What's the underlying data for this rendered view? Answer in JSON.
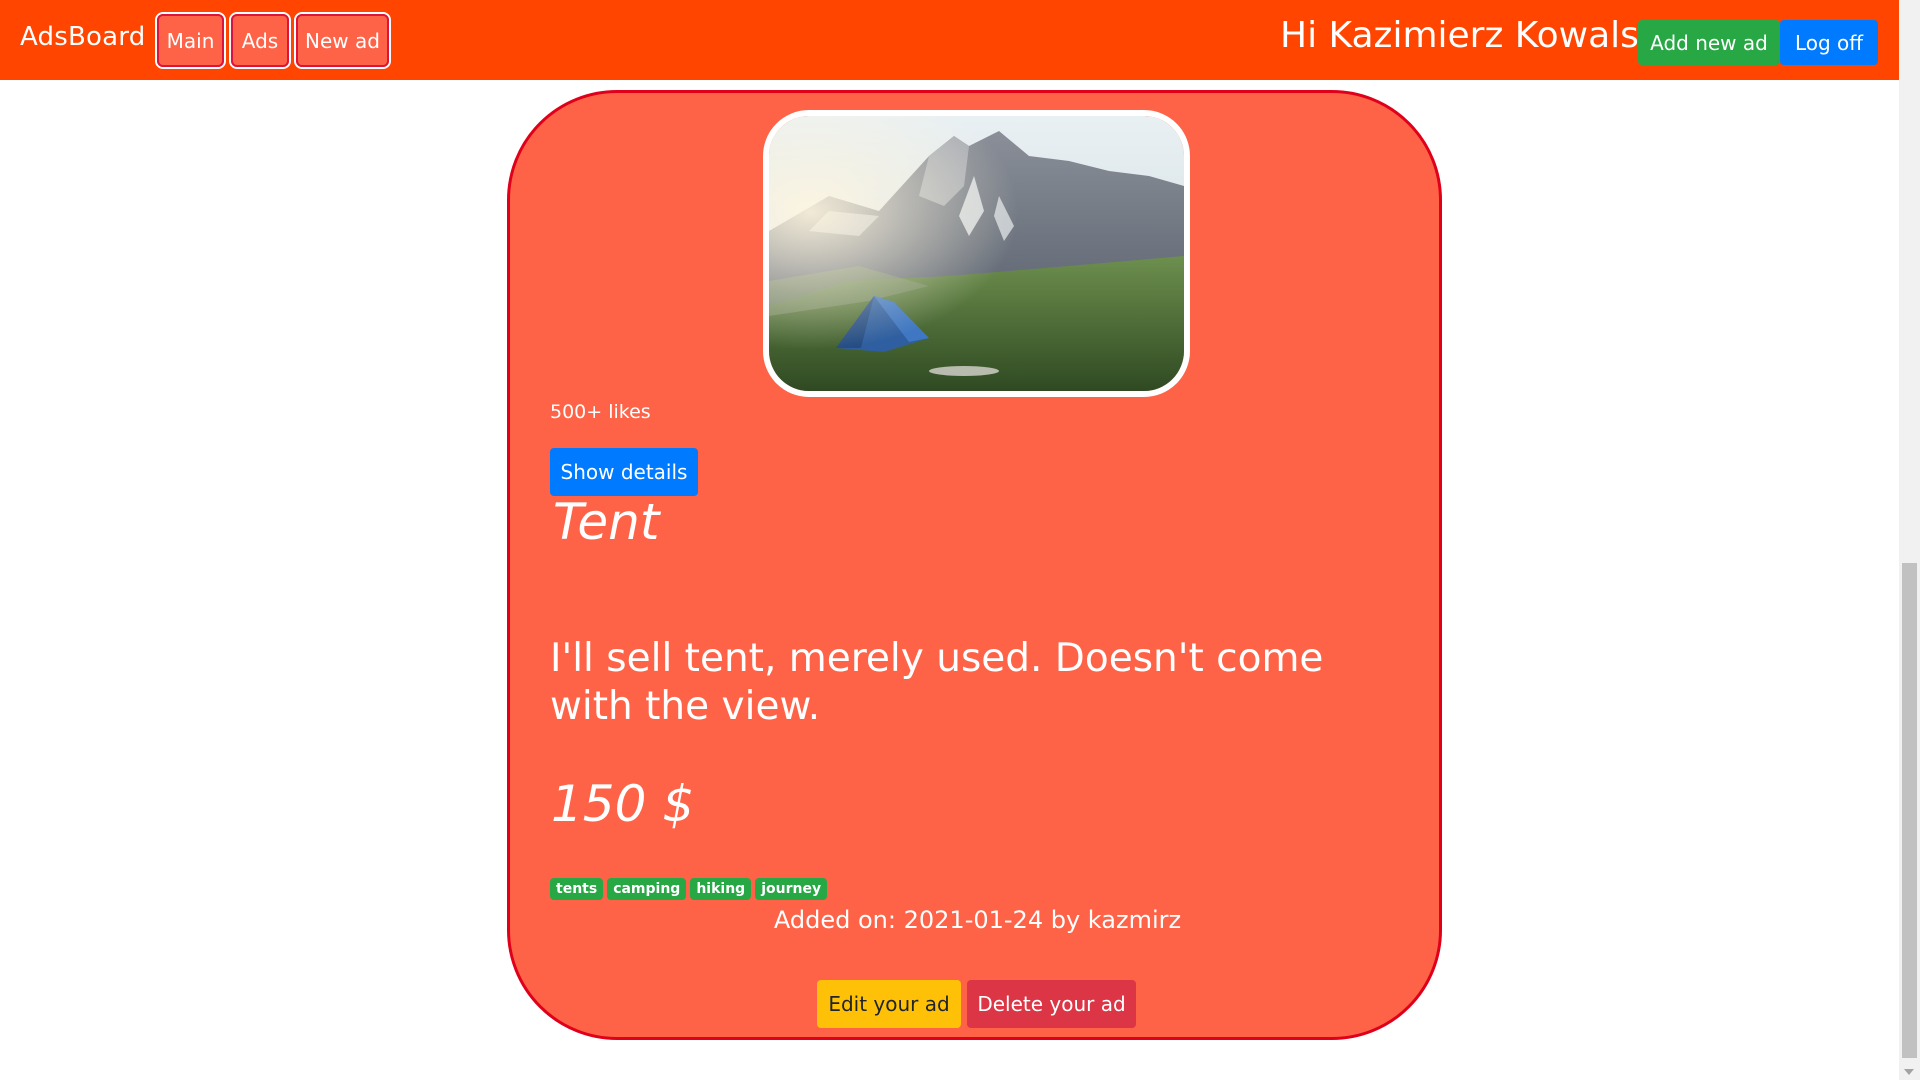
{
  "navbar": {
    "brand": "AdsBoard",
    "links": [
      "Main",
      "Ads",
      "New ad"
    ],
    "greeting": "Hi Kazimierz Kowalski",
    "add_button": "Add new ad",
    "logoff_button": "Log off",
    "colors": {
      "background": "#ff4500",
      "add": "#28a745",
      "logoff": "#007bff"
    }
  },
  "ad": {
    "image_icon": "mountain-tent-photo",
    "likes": "500+ likes",
    "details_button": "Show details",
    "title": "Tent",
    "description": "I'll sell tent, merely used. Doesn't come with the view.",
    "price": "150 $",
    "tags": [
      "tents",
      "camping",
      "hiking",
      "journey"
    ],
    "added": "Added on: 2021-01-24 by kazmirz",
    "edit_button": "Edit your ad",
    "delete_button": "Delete your ad",
    "colors": {
      "card": "#ff6347",
      "border": "#e0001a",
      "edit": "#ffc107",
      "delete": "#dc3545",
      "tag": "#28a745"
    }
  },
  "scrollbar": {
    "position_fraction": 0.52
  }
}
